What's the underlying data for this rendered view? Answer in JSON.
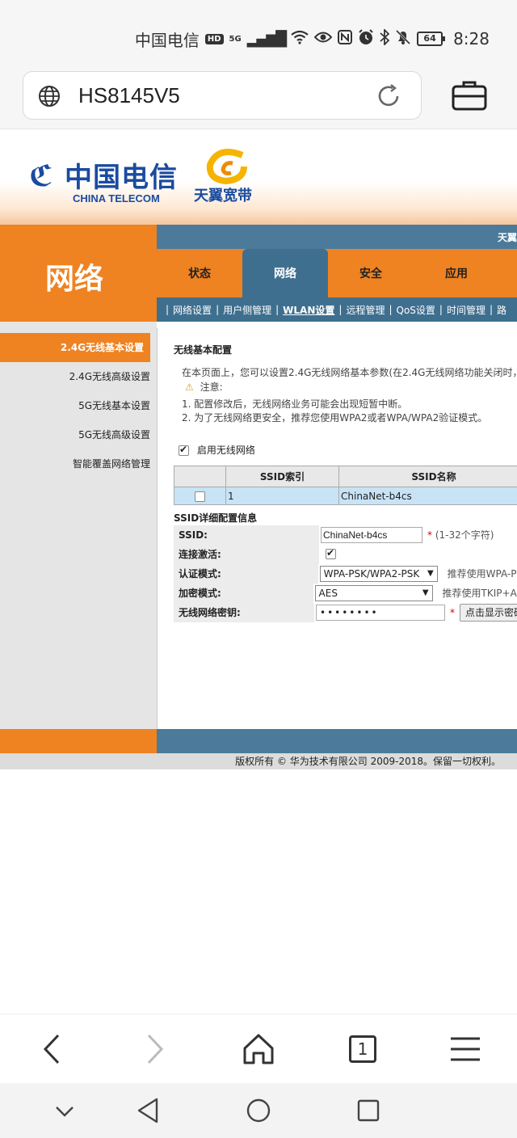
{
  "status_bar": {
    "carrier": "中国电信",
    "hd": "HD",
    "network": "5G",
    "battery": "64",
    "time": "8:28"
  },
  "browser": {
    "url": "HS8145V5",
    "icons": [
      "globe-icon",
      "reload-icon",
      "briefcase-icon"
    ]
  },
  "header": {
    "logo_cn": "中国电信",
    "logo_en": "CHINA TELECOM",
    "tianyi": "天翼宽带"
  },
  "page": {
    "title": "网络",
    "top_bar_text": "天翼",
    "tabs": [
      "状态",
      "网络",
      "安全",
      "应用"
    ],
    "subnav": [
      "网络设置",
      "用户侧管理",
      "WLAN设置",
      "远程管理",
      "QoS设置",
      "时间管理",
      "路"
    ]
  },
  "left_menu": [
    "2.4G无线基本设置",
    "2.4G无线高级设置",
    "5G无线基本设置",
    "5G无线高级设置",
    "智能覆盖网络管理"
  ],
  "content": {
    "section_title": "无线基本配置",
    "description": "在本页面上，您可以设置2.4G无线网络基本参数(在2.4G无线网络功能关闭时，显",
    "note_label": "注意:",
    "note_1": "1. 配置修改后，无线网络业务可能会出现短暂中断。",
    "note_2": "2. 为了无线网络更安全，推荐您使用WPA2或者WPA/WPA2验证模式。",
    "enable_label": "启用无线网络",
    "table": {
      "headers": [
        "",
        "SSID索引",
        "SSID名称"
      ],
      "rows": [
        [
          "",
          "1",
          "ChinaNet-b4cs"
        ]
      ]
    },
    "detail_title": "SSID详细配置信息",
    "fields": {
      "ssid_label": "SSID:",
      "ssid_value": "ChinaNet-b4cs",
      "ssid_hint": "(1-32个字符)",
      "active_label": "连接激活:",
      "auth_label": "认证模式:",
      "auth_value": "WPA-PSK/WPA2-PSK",
      "auth_hint": "推荐使用WPA-PSK",
      "enc_label": "加密模式:",
      "enc_value": "AES",
      "enc_hint": "推荐使用TKIP+AES",
      "key_label": "无线网络密钥:",
      "key_value": "••••••••",
      "show_key_button": "点击显示密码"
    }
  },
  "footer": {
    "copyright": "版权所有 © 华为技术有限公司 2009-2018。保留一切权利。"
  },
  "toolbar": {
    "tab_count": "1"
  }
}
